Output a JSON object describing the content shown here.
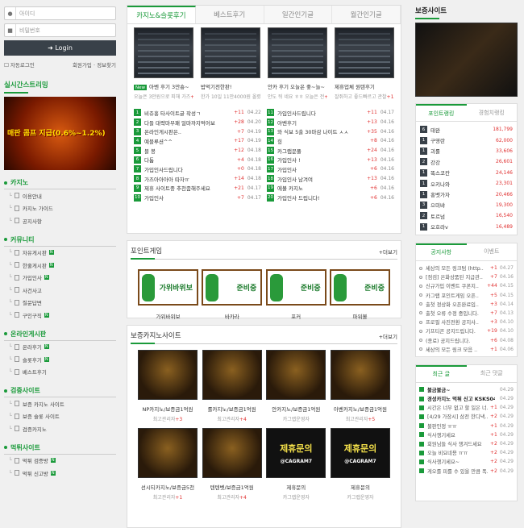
{
  "login": {
    "id_placeholder": "아이디",
    "pw_placeholder": "비밀번호",
    "button": "Login",
    "auto": "자동로그인",
    "links": "회원가입 · 정보찾기"
  },
  "left": {
    "stream_title": "실시간스트리밍",
    "banner_text": "매판 콤프 지급(0.6%~1.2%)",
    "menus": [
      {
        "title": "카지노",
        "items": [
          {
            "label": "이용안내",
            "new": false
          },
          {
            "label": "카지노 가이드",
            "new": false
          },
          {
            "label": "공지사항",
            "new": false
          }
        ]
      },
      {
        "title": "커뮤니티",
        "items": [
          {
            "label": "자유게시판",
            "new": true
          },
          {
            "label": "한줄게시판",
            "new": true
          },
          {
            "label": "가입인사",
            "new": true
          },
          {
            "label": "사건사고",
            "new": false
          },
          {
            "label": "질문답변",
            "new": false
          },
          {
            "label": "구인구직",
            "new": true
          }
        ]
      },
      {
        "title": "온라인게시판",
        "items": [
          {
            "label": "온라후기",
            "new": true
          },
          {
            "label": "슬롯후기",
            "new": true
          },
          {
            "label": "베스트후기",
            "new": false
          }
        ]
      },
      {
        "title": "검증사이트",
        "items": [
          {
            "label": "보증 카지노 사이트",
            "new": false
          },
          {
            "label": "보증 슬롯 사이트",
            "new": false
          },
          {
            "label": "검증카지노",
            "new": false
          }
        ]
      },
      {
        "title": "먹튀사이트",
        "items": [
          {
            "label": "먹튀 검증방",
            "new": true
          },
          {
            "label": "먹튀 신고방",
            "new": true
          }
        ]
      }
    ]
  },
  "tabs": [
    "카지노&슬롯후기",
    "베스트후기",
    "일간인기글",
    "월간인기글"
  ],
  "thumbs": [
    {
      "title": "아벤 후기 3만숑~",
      "sub": "오늘은 3만원으로 피해 가즈",
      "cnt": "+1",
      "new": true
    },
    {
      "title": "밥먹기전한판!",
      "sub": "한가 10일 11만4000원 올렸다",
      "cnt": "+3",
      "new": false
    },
    {
      "title": "안카 후기 오늘은 좋~늘~",
      "sub": "안도 뒤 네요 ㅎㅎ 오늘은 전",
      "cnt": "+5",
      "new": false
    },
    {
      "title": "제휴업체 원텐후기",
      "sub": "잘쥐하고 좋드빠르고 관찰",
      "cnt": "+13",
      "new": false
    }
  ],
  "list_left": [
    {
      "n": "1",
      "t": "비쥬홍 타사이트글 작성ㄱ",
      "c": "+11",
      "d": "04.22"
    },
    {
      "n": "2",
      "t": "다들 대략마부패 얼마까지먹어보",
      "c": "+28",
      "d": "04.20"
    },
    {
      "n": "3",
      "t": "온라인게시판은..",
      "c": "+7",
      "d": "04.19"
    },
    {
      "n": "4",
      "t": "예블루션^^",
      "c": "+17",
      "d": "04.19"
    },
    {
      "n": "5",
      "t": "블 봉",
      "c": "+12",
      "d": "04.18"
    },
    {
      "n": "6",
      "t": "다툼",
      "c": "+4",
      "d": "04.18"
    },
    {
      "n": "7",
      "t": "가입인사드립니다",
      "c": "+0",
      "d": "04.18"
    },
    {
      "n": "8",
      "t": "가즈아아아아 따자ㅠ",
      "c": "+14",
      "d": "04.18"
    },
    {
      "n": "9",
      "t": "제휴 사이트중 추천좀해주세요",
      "c": "+21",
      "d": "04.17"
    },
    {
      "n": "10",
      "t": "가입인사",
      "c": "+7",
      "d": "04.17"
    }
  ],
  "list_right": [
    {
      "n": "11",
      "t": "가입인사드립니다",
      "c": "+11",
      "d": "04.17"
    },
    {
      "n": "12",
      "t": "아벤후기",
      "c": "+13",
      "d": "04.16"
    },
    {
      "n": "13",
      "t": "와 식보 5출 30마감 나이트 ㅅㅅ",
      "c": "+35",
      "d": "04.16"
    },
    {
      "n": "14",
      "t": "힝",
      "c": "+8",
      "d": "04.16"
    },
    {
      "n": "15",
      "t": "카그랩문풀",
      "c": "+24",
      "d": "04.16"
    },
    {
      "n": "16",
      "t": "가입인사 !",
      "c": "+13",
      "d": "04.16"
    },
    {
      "n": "17",
      "t": "가입인사",
      "c": "+6",
      "d": "04.16"
    },
    {
      "n": "18",
      "t": "가입인사 남겨여",
      "c": "+13",
      "d": "04.16"
    },
    {
      "n": "19",
      "t": "에볼 카지노",
      "c": "+6",
      "d": "04.16"
    },
    {
      "n": "20",
      "t": "가입인사 드립니다!",
      "c": "+6",
      "d": "04.16"
    }
  ],
  "point_game": {
    "title": "포인트게임",
    "more": "+더보기",
    "items": [
      {
        "label": "가위바위보",
        "img": "가위바위보"
      },
      {
        "label": "바카라",
        "img": "준비중"
      },
      {
        "label": "포커",
        "img": "준비중"
      },
      {
        "label": "파워볼",
        "img": "준비중"
      }
    ]
  },
  "casino": {
    "title": "보증카지노사이트",
    "more": "+더보기",
    "items": [
      {
        "a": "NP카지노/보증금1억원",
        "b": "최고관리자",
        "c": "+3"
      },
      {
        "a": "롤카지노/보증금1억원",
        "b": "최고관리자",
        "c": "+4"
      },
      {
        "a": "안카지노/보증금1억원",
        "b": "카그랩운영자",
        "c": ""
      },
      {
        "a": "아벤카지노/보증금1억원",
        "b": "최고관리자",
        "c": "+5"
      },
      {
        "a": "선시티카지노/보증금5천",
        "b": "최고관리자",
        "c": "+1"
      },
      {
        "a": "텐텐벳/보증금1억원",
        "b": "최고관리자",
        "c": "+4"
      },
      {
        "a": "제휴문의",
        "b": "카그랩운영자",
        "c": "",
        "tele": "제휴문의",
        "handle": "@CAGRAM7"
      },
      {
        "a": "제휴문의",
        "b": "카그랩운영자",
        "c": "",
        "tele": "제휴문의",
        "handle": "@CAGRAM7"
      }
    ]
  },
  "right": {
    "guarantee": "보증사이트",
    "rank_tabs": [
      "포인트랭킹",
      "경험치랭킹"
    ],
    "ranks": [
      {
        "n": "6",
        "t": "태완",
        "p": "181,799"
      },
      {
        "n": "1",
        "t": "구영란",
        "p": "62,000"
      },
      {
        "n": "1",
        "t": "괴롤",
        "p": "33,606"
      },
      {
        "n": "2",
        "t": "강강",
        "p": "26,601"
      },
      {
        "n": "1",
        "t": "똑스코칸",
        "p": "24,146"
      },
      {
        "n": "1",
        "t": "오키나와",
        "p": "23,301"
      },
      {
        "n": "1",
        "t": "홍벳가자",
        "p": "20,466"
      },
      {
        "n": "3",
        "t": "으미뱌",
        "p": "19,300"
      },
      {
        "n": "2",
        "t": "토르넘",
        "p": "16,540"
      },
      {
        "n": "1",
        "t": "오호라v",
        "p": "16,489"
      }
    ],
    "notice_tabs": [
      "공지사항",
      "이벤트"
    ],
    "notices": [
      {
        "t": "세상의 모든 링크텀 (http..",
        "c": "+1",
        "d": "04.27"
      },
      {
        "t": "[점검] 온화상품된 지급관..",
        "c": "+7",
        "d": "04.16"
      },
      {
        "t": "신규가입 이벤트 쿠폰지..",
        "c": "+44",
        "d": "04.15"
      },
      {
        "t": "카그랩 포인트게임 오픈..",
        "c": "+5",
        "d": "04.15"
      },
      {
        "t": "출첫 정상화 오픈완료입..",
        "c": "+3",
        "d": "04.14"
      },
      {
        "t": "출첫 오류 수정 중입니다.",
        "c": "+7",
        "d": "04.13"
      },
      {
        "t": "프로필 사진전환 공지사..",
        "c": "+3",
        "d": "04.10"
      },
      {
        "t": "기프티콘 공지드립니다.",
        "c": "+19",
        "d": "04.10"
      },
      {
        "t": "(종료) 공지드립니다.",
        "c": "+6",
        "d": "04.08"
      },
      {
        "t": "세상의 모든 링크 모음 ..",
        "c": "+1",
        "d": "04.06"
      }
    ],
    "recent_tabs": [
      "최근 글",
      "최근 댓글"
    ],
    "recents": [
      {
        "t": "불금불금~",
        "c": "",
        "d": "04.29",
        "bold": true
      },
      {
        "t": "경성카지노 먹튀 신고 KSKS040..",
        "c": "",
        "d": "04.29",
        "bold": true
      },
      {
        "t": "시간은 너무 없고 할 일은 너..",
        "c": "+1",
        "d": "04.29",
        "bold": false
      },
      {
        "t": "[4/29 가장시] 삼전 한디낵..",
        "c": "+2",
        "d": "04.29",
        "bold": false
      },
      {
        "t": "불판인정 ㅠㅠ",
        "c": "+1",
        "d": "04.29",
        "bold": false
      },
      {
        "t": "식사챙기세요",
        "c": "+1",
        "d": "04.29",
        "bold": false
      },
      {
        "t": "회원님들 식사 챙겨드세요",
        "c": "+2",
        "d": "04.29",
        "bold": false
      },
      {
        "t": "오늘 비요네용 ㅠㅠ",
        "c": "+2",
        "d": "04.29",
        "bold": false
      },
      {
        "t": "식사챙기세요~",
        "c": "+2",
        "d": "04.29",
        "bold": false
      },
      {
        "t": "게오를 피를 수 있을 만큼 폭..",
        "c": "+2",
        "d": "04.29",
        "bold": false
      }
    ]
  }
}
